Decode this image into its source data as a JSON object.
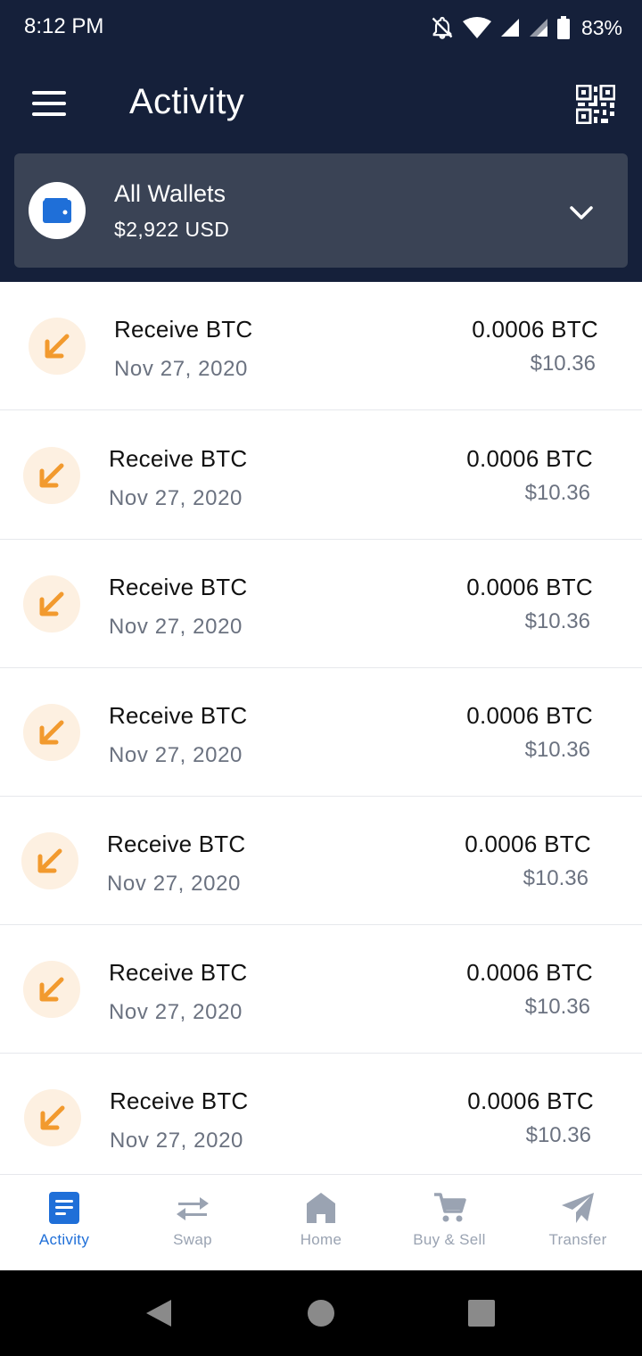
{
  "status_bar": {
    "time": "8:12 PM",
    "battery": "83%",
    "icons": [
      "bell-off-icon",
      "wifi-icon",
      "signal-icon",
      "signal-icon",
      "battery-icon"
    ]
  },
  "app_bar": {
    "title": "Activity",
    "menu_icon": "hamburger-menu-icon",
    "qr_icon": "qr-code-icon"
  },
  "wallet_selector": {
    "name": "All Wallets",
    "balance": "$2,922 USD",
    "icon": "wallet-icon",
    "chevron": "chevron-down-icon"
  },
  "transactions": [
    {
      "title": "Receive BTC",
      "date": "Nov 27, 2020",
      "amount": "0.0006 BTC",
      "usd": "$10.36"
    },
    {
      "title": "Receive BTC",
      "date": "Nov 27, 2020",
      "amount": "0.0006 BTC",
      "usd": "$10.36"
    },
    {
      "title": "Receive BTC",
      "date": "Nov 27, 2020",
      "amount": "0.0006 BTC",
      "usd": "$10.36"
    },
    {
      "title": "Receive BTC",
      "date": "Nov 27, 2020",
      "amount": "0.0006 BTC",
      "usd": "$10.36"
    },
    {
      "title": "Receive BTC",
      "date": "Nov 27, 2020",
      "amount": "0.0006 BTC",
      "usd": "$10.36"
    },
    {
      "title": "Receive BTC",
      "date": "Nov 27, 2020",
      "amount": "0.0006 BTC",
      "usd": "$10.36"
    },
    {
      "title": "Receive BTC",
      "date": "Nov 27, 2020",
      "amount": "0.0006 BTC",
      "usd": "$10.36"
    }
  ],
  "bottom_nav": {
    "items": [
      {
        "label": "Activity",
        "icon": "activity-icon",
        "active": true
      },
      {
        "label": "Swap",
        "icon": "swap-icon",
        "active": false
      },
      {
        "label": "Home",
        "icon": "home-icon",
        "active": false
      },
      {
        "label": "Buy & Sell",
        "icon": "cart-icon",
        "active": false
      },
      {
        "label": "Transfer",
        "icon": "send-icon",
        "active": false
      }
    ]
  },
  "colors": {
    "header_bg": "#15203a",
    "wallet_card_bg": "#3a4355",
    "accent_blue": "#1f6fd8",
    "receive_orange": "#f29a2e",
    "receive_icon_bg": "#fdf0e1",
    "inactive_nav": "#9aa3b2"
  }
}
